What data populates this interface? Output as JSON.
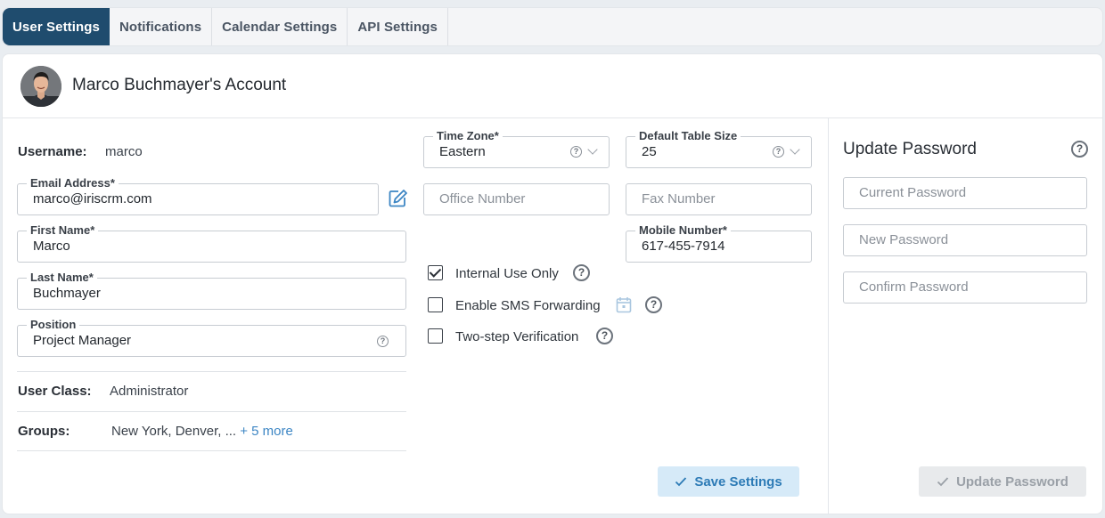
{
  "tabs": [
    {
      "label": "User Settings",
      "active": true
    },
    {
      "label": "Notifications",
      "active": false
    },
    {
      "label": "Calendar Settings",
      "active": false
    },
    {
      "label": "API Settings",
      "active": false
    }
  ],
  "account": {
    "title": "Marco Buchmayer's Account"
  },
  "user": {
    "username_label": "Username:",
    "username": "marco",
    "email_label": "Email Address*",
    "email": "marco@iriscrm.com",
    "first_name_label": "First Name*",
    "first_name": "Marco",
    "last_name_label": "Last Name*",
    "last_name": "Buchmayer",
    "position_label": "Position",
    "position": "Project Manager",
    "user_class_label": "User Class:",
    "user_class": "Administrator",
    "groups_label": "Groups:",
    "groups": "New York, Denver, ...",
    "groups_more": "+ 5 more"
  },
  "contact": {
    "time_zone_label": "Time Zone*",
    "time_zone": "Eastern",
    "table_size_label": "Default Table Size",
    "table_size": "25",
    "office_placeholder": "Office Number",
    "fax_placeholder": "Fax Number",
    "mobile_label": "Mobile Number*",
    "mobile": "617-455-7914"
  },
  "options": {
    "internal_use": {
      "label": "Internal Use Only",
      "checked": true
    },
    "sms_forwarding": {
      "label": "Enable SMS Forwarding",
      "checked": false
    },
    "two_step": {
      "label": "Two-step Verification",
      "checked": false
    }
  },
  "password": {
    "title": "Update Password",
    "current_placeholder": "Current Password",
    "new_placeholder": "New Password",
    "confirm_placeholder": "Confirm Password",
    "update_button": "Update Password"
  },
  "save_button": "Save Settings",
  "help_glyph": "?",
  "colors": {
    "active_tab": "#1f4c6e",
    "link": "#3d86c4",
    "save_bg": "#d6eaf8",
    "save_text": "#2d7bb6",
    "disabled_bg": "#e8eaec"
  }
}
